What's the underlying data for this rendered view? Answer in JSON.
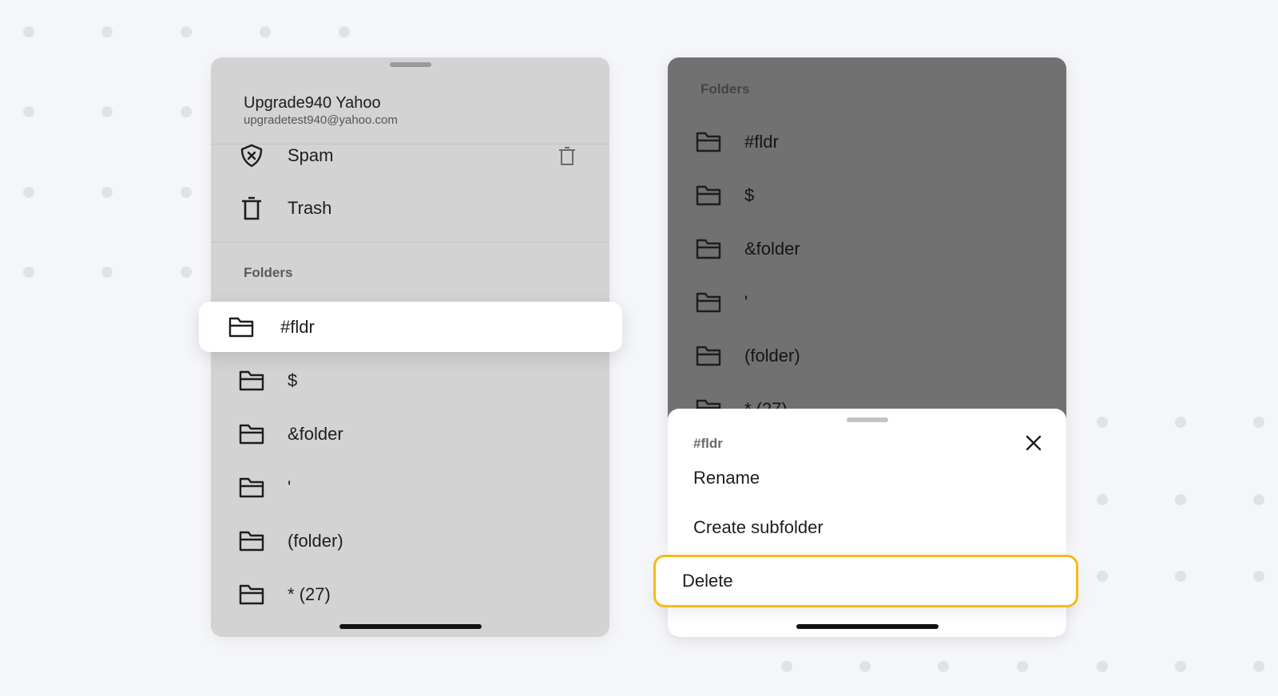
{
  "account": {
    "name": "Upgrade940 Yahoo",
    "email": "upgradetest940@yahoo.com"
  },
  "system_folders": [
    {
      "label": "Spam",
      "icon": "shield-x-icon",
      "trailing_icon": "trash-icon"
    },
    {
      "label": "Trash",
      "icon": "trash-icon"
    }
  ],
  "folders_section_label": "Folders",
  "dragged_folder": {
    "label": "#fldr",
    "icon": "folder-icon"
  },
  "left_folders": [
    {
      "label": "$"
    },
    {
      "label": "&folder"
    },
    {
      "label": "'"
    },
    {
      "label": "(folder)"
    },
    {
      "label": "* (27)"
    }
  ],
  "right_folders": [
    {
      "label": "#fldr"
    },
    {
      "label": "$"
    },
    {
      "label": "&folder"
    },
    {
      "label": "'"
    },
    {
      "label": "(folder)"
    },
    {
      "label": "* (27)"
    }
  ],
  "action_sheet": {
    "title": "#fldr",
    "close_icon": "close-icon",
    "items": [
      {
        "label": "Rename"
      },
      {
        "label": "Create subfolder"
      },
      {
        "label": "Delete",
        "highlighted": true
      }
    ]
  },
  "colors": {
    "highlight_border": "#f5bb1a",
    "overlay": "#717171",
    "panel_bg": "#d3d3d3"
  }
}
